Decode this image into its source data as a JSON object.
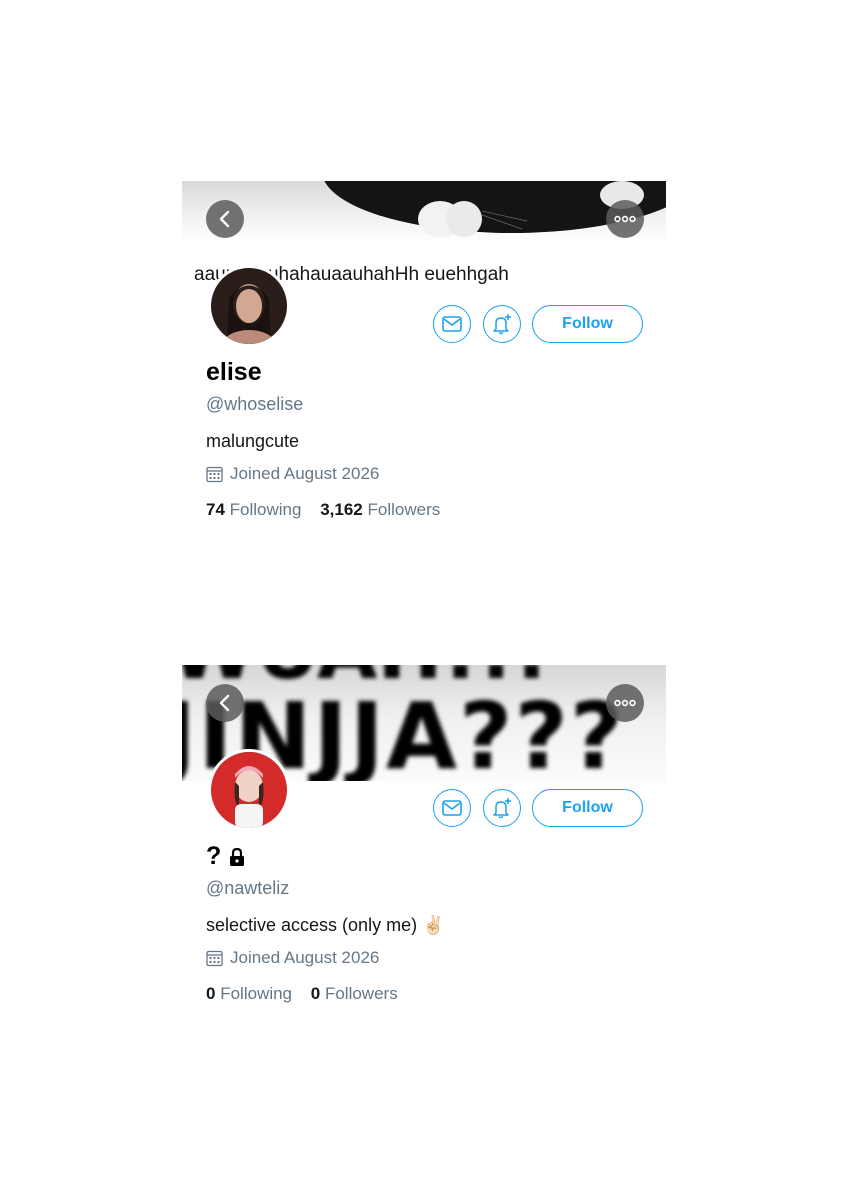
{
  "profiles": [
    {
      "banner_overlay_text": "aauuuuuuhahauaauhahHh euehhgah",
      "name": "elise",
      "handle": "@whoselise",
      "bio": "malungcute",
      "joined": "Joined August 2026",
      "following_count": "74",
      "following_label": "Following",
      "followers_count": "3,162",
      "followers_label": "Followers",
      "follow_label": "Follow"
    },
    {
      "banner_text": "JINJJA???",
      "name": "?",
      "handle": "@nawteliz",
      "bio": "selective access (only me) ✌🏻",
      "joined": "Joined August 2026",
      "following_count": "0",
      "following_label": "Following",
      "followers_count": "0",
      "followers_label": "Followers",
      "follow_label": "Follow"
    }
  ],
  "icons": {
    "back": "chevron-left-icon",
    "more": "more-horizontal-icon",
    "message": "envelope-icon",
    "notifications": "bell-plus-icon",
    "calendar": "calendar-icon",
    "lock": "lock-icon"
  },
  "colors": {
    "accent": "#1da1f2",
    "secondary_text": "#657786",
    "primary_text": "#14171a"
  }
}
